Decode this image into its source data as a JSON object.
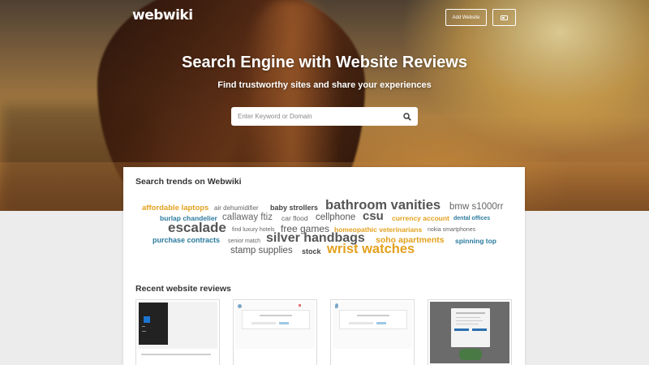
{
  "header": {
    "logo": "webwiki",
    "add_website_label": "Add Website"
  },
  "hero": {
    "title": "Search Engine with Website Reviews",
    "subtitle": "Find trustworthy sites and share your experiences",
    "search_placeholder": "Enter Keyword or Domain"
  },
  "trends": {
    "heading": "Search trends on Webwiki",
    "terms": [
      {
        "text": "affordable laptops",
        "color": "#e3a11e"
      },
      {
        "text": "air dehumidifier",
        "color": "#666666"
      },
      {
        "text": "baby strollers",
        "color": "#444444"
      },
      {
        "text": "bathroom vanities",
        "color": "#555555"
      },
      {
        "text": "bmw s1000rr",
        "color": "#666666"
      },
      {
        "text": "burlap chandelier",
        "color": "#2b7a9e"
      },
      {
        "text": "callaway ftiz",
        "color": "#666666"
      },
      {
        "text": "car flood",
        "color": "#666666"
      },
      {
        "text": "cellphone",
        "color": "#555555"
      },
      {
        "text": "csu",
        "color": "#555555"
      },
      {
        "text": "currency account",
        "color": "#e3a11e"
      },
      {
        "text": "dental offices",
        "color": "#2b7a9e"
      },
      {
        "text": "escalade",
        "color": "#555555"
      },
      {
        "text": "find luxury hotels",
        "color": "#666666"
      },
      {
        "text": "free games",
        "color": "#666666"
      },
      {
        "text": "homeopathic veterinarians",
        "color": "#e3a11e"
      },
      {
        "text": "nokia smartphones",
        "color": "#666666"
      },
      {
        "text": "purchase contracts",
        "color": "#2b7a9e"
      },
      {
        "text": "senior match",
        "color": "#666666"
      },
      {
        "text": "silver handbags",
        "color": "#555555"
      },
      {
        "text": "soho apartments",
        "color": "#e3a11e"
      },
      {
        "text": "spinning top",
        "color": "#2b7a9e"
      },
      {
        "text": "stamp supplies",
        "color": "#666666"
      },
      {
        "text": "stock",
        "color": "#444444"
      },
      {
        "text": "wrist watches",
        "color": "#e3a11e"
      }
    ]
  },
  "recent": {
    "heading": "Recent website reviews"
  },
  "colors": {
    "accent": "#e3a11e",
    "link_blue": "#2b7a9e",
    "card_bg": "#ffffff",
    "page_bg": "#ececec"
  }
}
